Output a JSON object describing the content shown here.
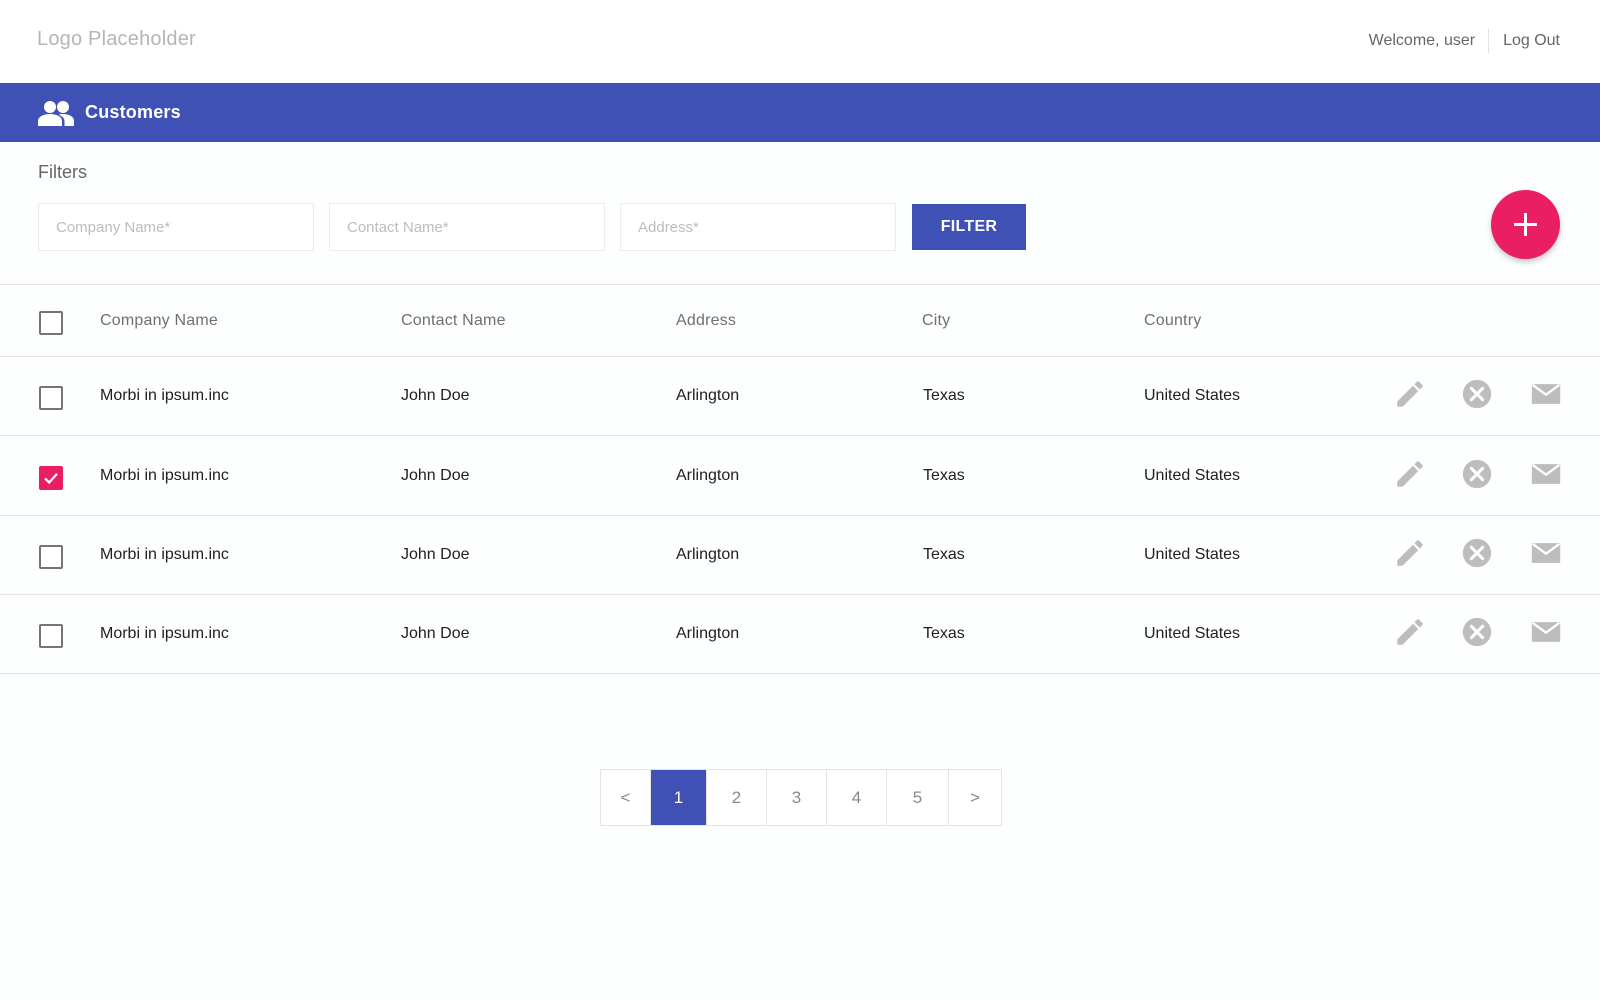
{
  "header": {
    "logo": "Logo Placeholder",
    "welcome": "Welcome, user",
    "logout": "Log Out"
  },
  "titlebar": {
    "icon": "people-icon",
    "title": "Customers"
  },
  "colors": {
    "primary": "#3f51b5",
    "accent": "#e91e63",
    "icon_grey": "#bdbdbd"
  },
  "filters": {
    "label": "Filters",
    "company_placeholder": "Company Name*",
    "contact_placeholder": "Contact Name*",
    "address_placeholder": "Address*",
    "button": "FILTER",
    "add_icon": "plus-icon"
  },
  "table": {
    "columns": [
      "Company Name",
      "Contact Name",
      "Address",
      "City",
      "Country"
    ],
    "rows": [
      {
        "checked": false,
        "company": "Morbi in ipsum.inc",
        "contact": "John Doe",
        "address": "Arlington",
        "city": "Texas",
        "country": "United States"
      },
      {
        "checked": true,
        "company": "Morbi in ipsum.inc",
        "contact": "John Doe",
        "address": "Arlington",
        "city": "Texas",
        "country": "United States"
      },
      {
        "checked": false,
        "company": "Morbi in ipsum.inc",
        "contact": "John Doe",
        "address": "Arlington",
        "city": "Texas",
        "country": "United States"
      },
      {
        "checked": false,
        "company": "Morbi in ipsum.inc",
        "contact": "John Doe",
        "address": "Arlington",
        "city": "Texas",
        "country": "United States"
      }
    ],
    "row_actions": [
      "pencil-icon",
      "close-circle-icon",
      "mail-icon"
    ]
  },
  "pagination": {
    "prev": "<",
    "pages": [
      "1",
      "2",
      "3",
      "4",
      "5"
    ],
    "current": "1",
    "next": ">"
  }
}
